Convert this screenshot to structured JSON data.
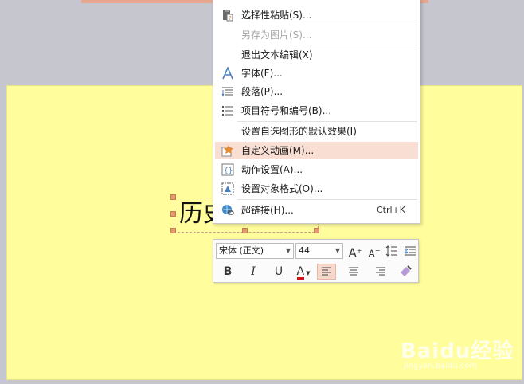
{
  "context_menu": {
    "items": [
      {
        "label": "选择性粘贴(S)...",
        "icon": "paste-special-icon",
        "disabled": false
      },
      {
        "label": "另存为图片(S)...",
        "icon": "",
        "disabled": true
      },
      {
        "label": "退出文本编辑(X)",
        "icon": "",
        "disabled": false
      },
      {
        "label": "字体(F)...",
        "icon": "font-icon",
        "disabled": false
      },
      {
        "label": "段落(P)...",
        "icon": "paragraph-icon",
        "disabled": false
      },
      {
        "label": "项目符号和编号(B)...",
        "icon": "bullets-icon",
        "disabled": false
      },
      {
        "label": "设置自选图形的默认效果(I)",
        "icon": "",
        "disabled": false
      },
      {
        "label": "自定义动画(M)...",
        "icon": "custom-animation-icon",
        "disabled": false,
        "highlighted": true
      },
      {
        "label": "动作设置(A)...",
        "icon": "action-settings-icon",
        "disabled": false
      },
      {
        "label": "设置对象格式(O)...",
        "icon": "object-format-icon",
        "disabled": false
      },
      {
        "label": "超链接(H)...",
        "icon": "hyperlink-icon",
        "disabled": false,
        "shortcut": "Ctrl+K"
      }
    ]
  },
  "slide": {
    "text": "历史"
  },
  "mini_toolbar": {
    "font_name": "宋体 (正文)",
    "font_size": "44",
    "bold": "B",
    "italic": "I",
    "underline": "U",
    "font_color_letter": "A",
    "grow_letter": "A",
    "shrink_letter": "A",
    "font_color": "#d0121b",
    "accent": "#f6d8cc"
  },
  "watermark": {
    "main": "Baidu经验",
    "sub": "jingyan.baidu.com"
  }
}
